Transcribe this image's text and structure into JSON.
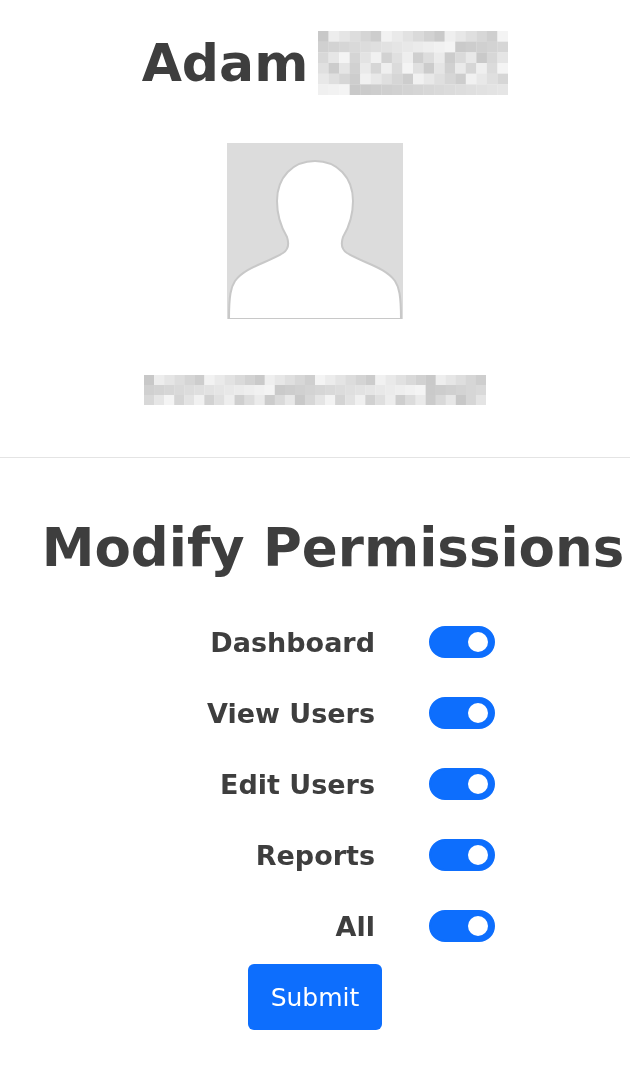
{
  "profile": {
    "name": "Adam"
  },
  "section_title": "Modify Permissions",
  "permissions": [
    {
      "label": "Dashboard",
      "checked": true
    },
    {
      "label": "View Users",
      "checked": true
    },
    {
      "label": "Edit Users",
      "checked": true
    },
    {
      "label": "Reports",
      "checked": true
    },
    {
      "label": "All",
      "checked": true
    }
  ],
  "submit": {
    "label": "Submit"
  }
}
